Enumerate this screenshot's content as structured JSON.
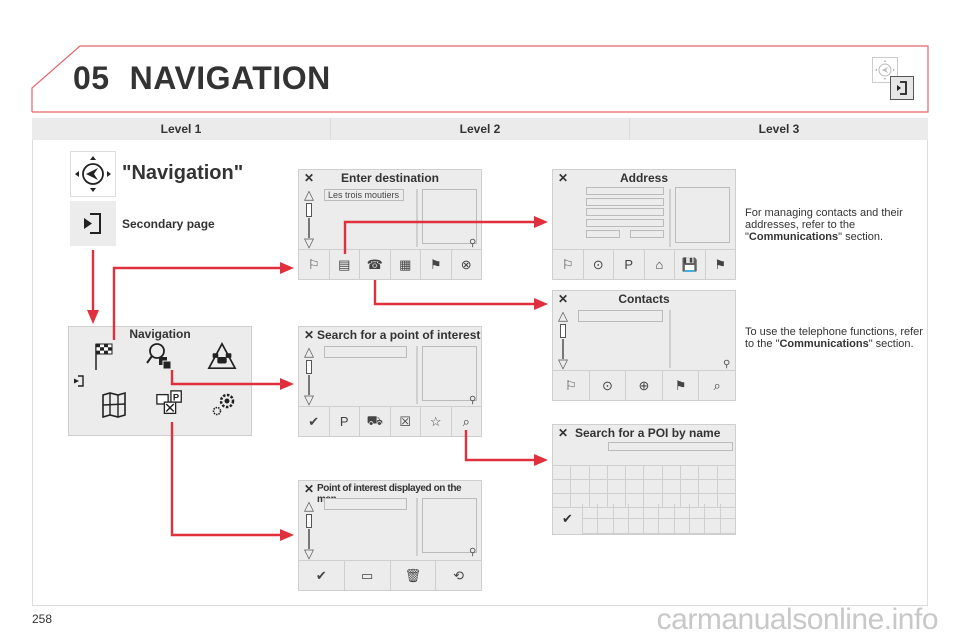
{
  "page": {
    "chapter_number": "05",
    "chapter_title": "NAVIGATION",
    "page_number": "258",
    "watermark": "carmanualsonline.info",
    "accent_color": "#e0303e"
  },
  "levels": [
    "Level 1",
    "Level 2",
    "Level 3"
  ],
  "level1": {
    "main_label": "\"Navigation\"",
    "main_icon": "navigation-compass-icon",
    "secondary_label": "Secondary page",
    "secondary_icon": "secondary-page-icon"
  },
  "nav_menu": {
    "title": "Navigation",
    "items": [
      {
        "icon": "checkered-flag-icon",
        "glyph": "⚑"
      },
      {
        "icon": "search-poi-icon",
        "glyph": "🔍"
      },
      {
        "icon": "traffic-icon",
        "glyph": "⚠"
      },
      {
        "icon": "map-icon",
        "glyph": "▦"
      },
      {
        "icon": "poi-categories-icon",
        "glyph": "P"
      },
      {
        "icon": "settings-gears-icon",
        "glyph": "⚙"
      }
    ],
    "back_glyph": "⇤"
  },
  "screens": {
    "enter_destination": {
      "title": "Enter destination",
      "input_value": "Les trois moutiers",
      "tools": [
        "⚐",
        "▤",
        "☎",
        "▦",
        "⚑",
        "⊗"
      ],
      "tool_names": [
        "destination-flag-icon",
        "address-card-icon",
        "contacts-book-icon",
        "map-grid-icon",
        "flag-icon",
        "crosshair-icon"
      ]
    },
    "search_poi": {
      "title": "Search for a point of interest",
      "tools": [
        "✔",
        "P",
        "⛟",
        "☒",
        "☆",
        "⌕"
      ],
      "tool_names": [
        "validate-icon",
        "poi-categories-icon",
        "car-icon",
        "hotel-icon",
        "favorites-star-icon",
        "search-by-name-icon"
      ]
    },
    "poi_on_map": {
      "title": "Point of interest displayed on the map",
      "tools": [
        "✔",
        "▭",
        "🗑",
        "⟲"
      ],
      "tool_names": [
        "validate-icon",
        "select-area-icon",
        "delete-icon",
        "refresh-poi-icon"
      ]
    },
    "address": {
      "title": "Address",
      "tools": [
        "⚐",
        "⊙",
        "P",
        "⌂",
        "💾",
        "⚑"
      ],
      "tool_names": [
        "destination-flag-icon",
        "gps-location-icon",
        "poi-icon",
        "home-icon",
        "save-icon",
        "waypoint-flag-icon"
      ]
    },
    "contacts": {
      "title": "Contacts",
      "tools": [
        "⚐",
        "⊙",
        "⊕",
        "⚑",
        "⌕"
      ],
      "tool_names": [
        "destination-flag-icon",
        "navigate-contact-icon",
        "add-contact-icon",
        "waypoint-flag-icon",
        "search-by-name-icon"
      ]
    },
    "poi_by_name": {
      "title": "Search for a POI by name",
      "ok_glyph": "✔"
    }
  },
  "close_glyph": "✕",
  "notes": [
    {
      "before": "For managing contacts and their addresses, refer to the \"",
      "bold": "Communications",
      "after": "\" section."
    },
    {
      "before": "To use the telephone functions, refer to the \"",
      "bold": "Communications",
      "after": "\" section."
    }
  ]
}
